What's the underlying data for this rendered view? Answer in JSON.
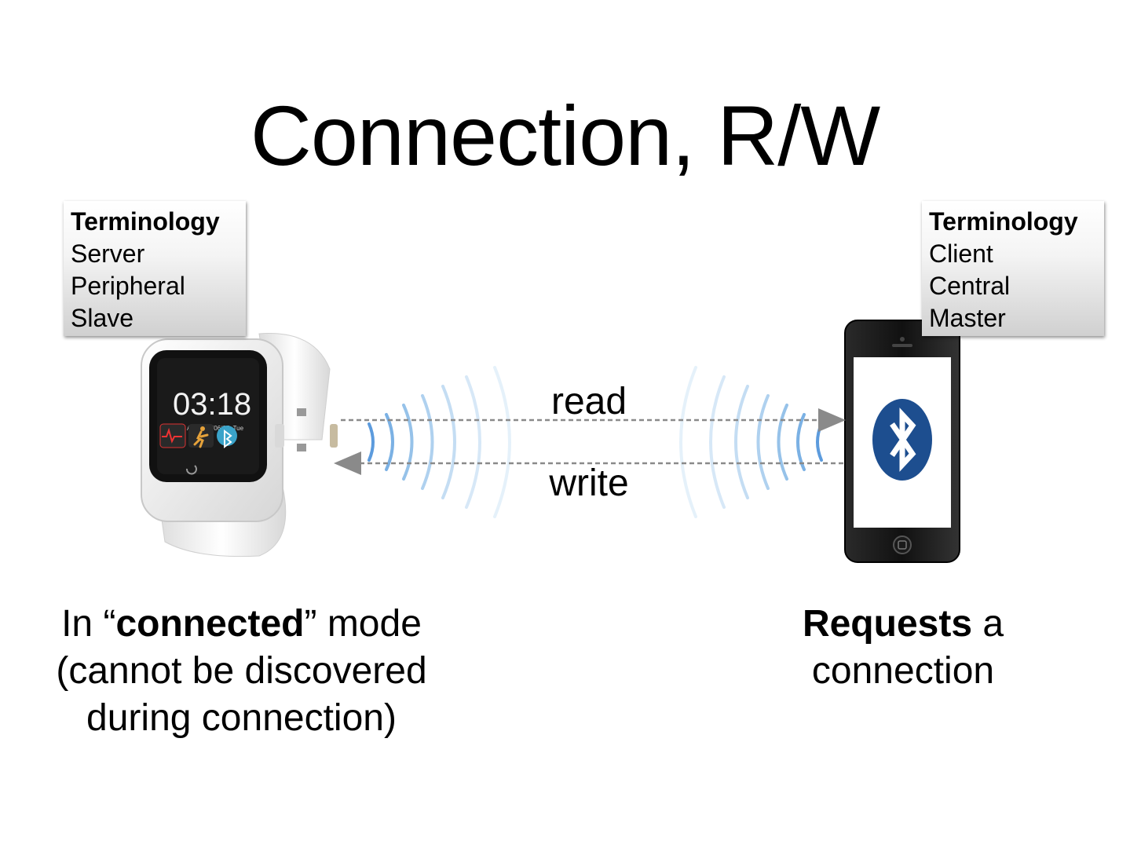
{
  "slide": {
    "title": "Connection, R/W"
  },
  "left_terminology": {
    "heading": "Terminology",
    "items": [
      "Server",
      "Peripheral",
      "Slave"
    ]
  },
  "right_terminology": {
    "heading": "Terminology",
    "items": [
      "Client",
      "Central",
      "Master"
    ]
  },
  "arrows": {
    "read_label": "read",
    "write_label": "write"
  },
  "watch": {
    "time": "03:18",
    "date": "AM 2014/06/05, Tue"
  },
  "left_caption": {
    "line1_pre": "In “",
    "line1_bold": "connected",
    "line1_post": "” mode",
    "line2": "(cannot be discovered",
    "line3": "during connection)"
  },
  "right_caption": {
    "line1_bold": "Requests",
    "line1_post": " a",
    "line2": "connection"
  },
  "colors": {
    "arrow": "#8a8a8a",
    "wave": "#7fb3df",
    "bluetooth": "#1d4e8f"
  }
}
